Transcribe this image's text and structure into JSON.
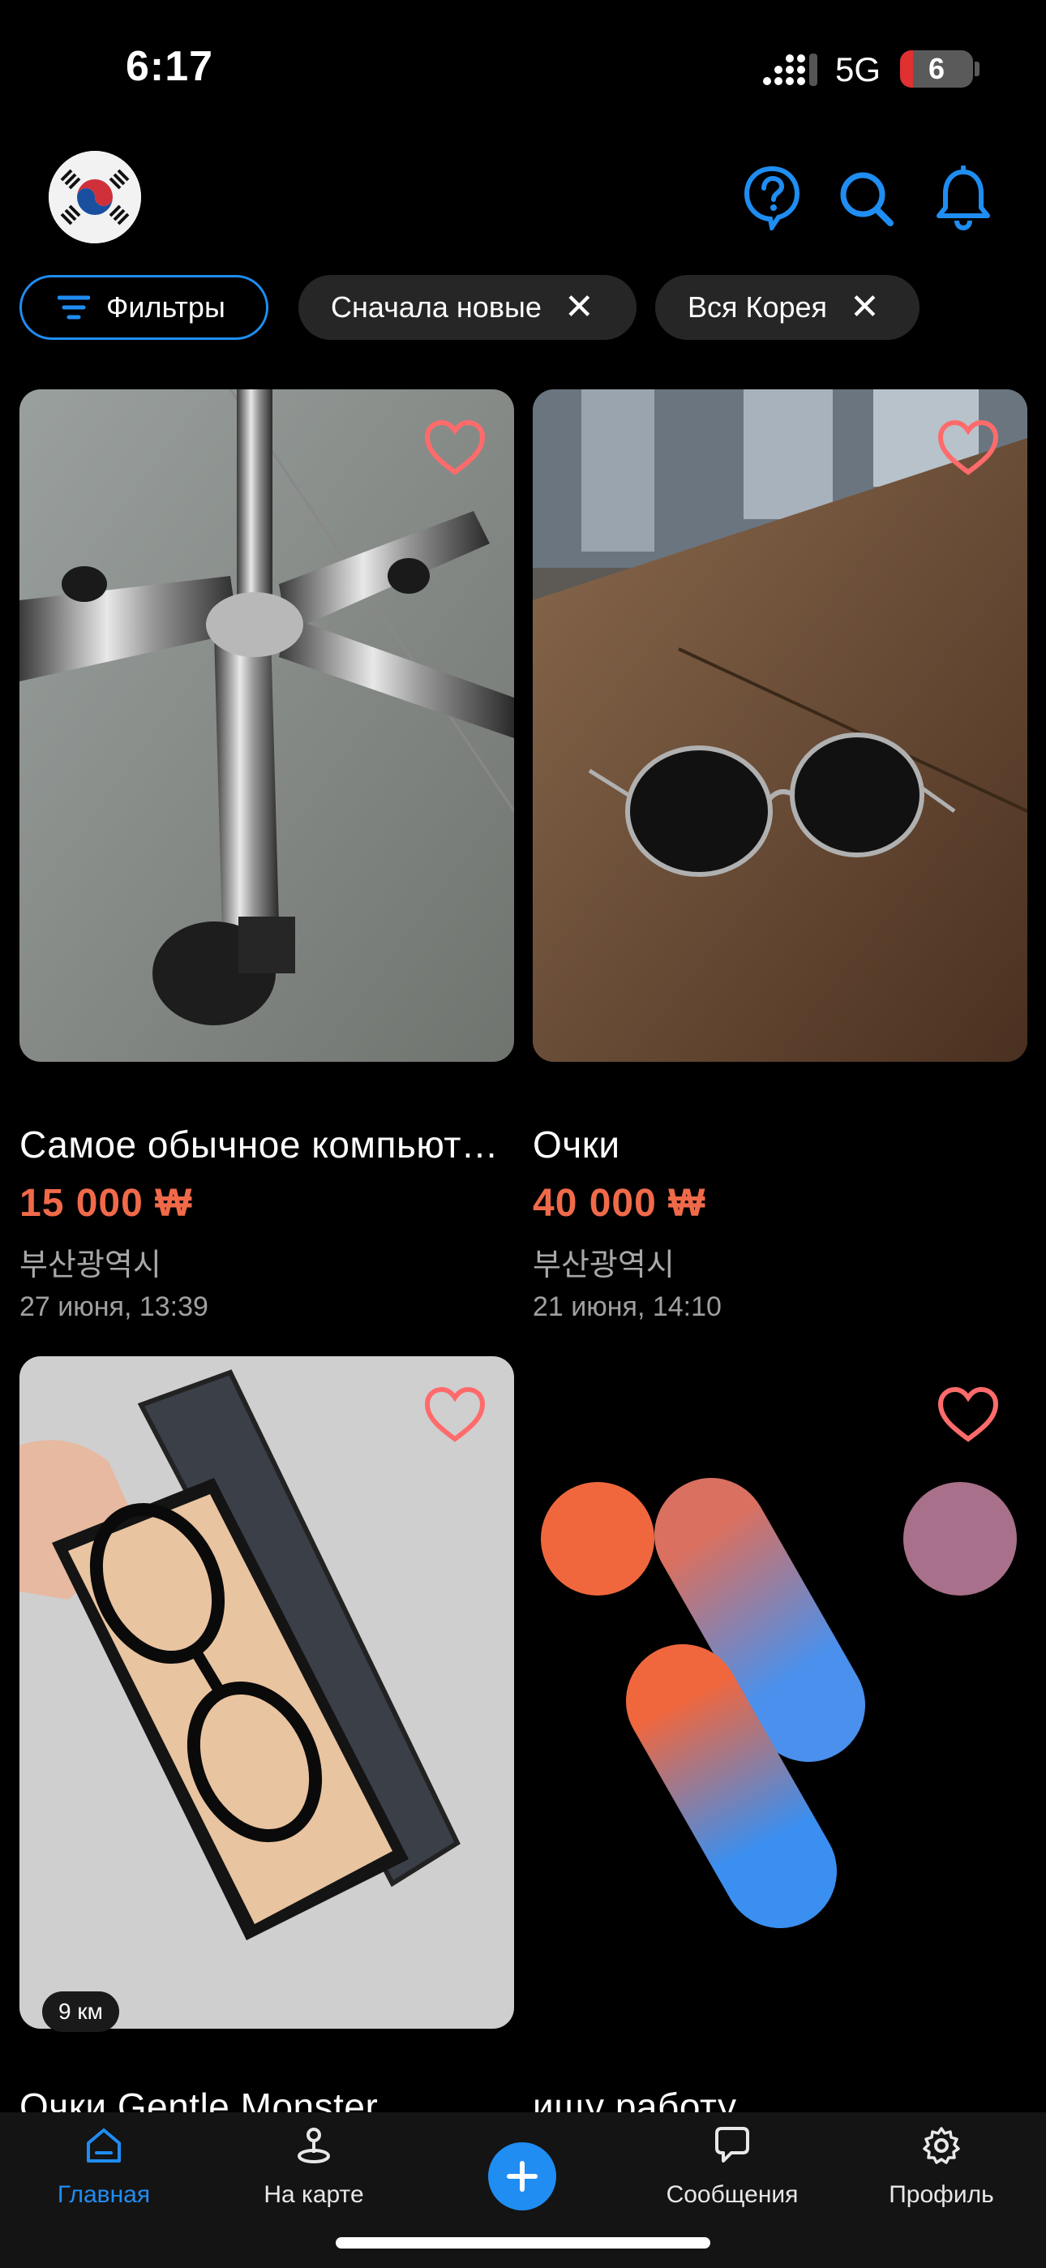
{
  "status": {
    "time": "6:17",
    "network": "5G",
    "battery": "6"
  },
  "header": {
    "flag_icon": "korea-flag-icon",
    "icons": [
      "help-icon",
      "search-icon",
      "bell-icon"
    ],
    "accent": "#1f8df2"
  },
  "chips": {
    "filters": "Фильтры",
    "sort": "Сначала новые",
    "region": "Вся Корея",
    "remove_glyph": "✕"
  },
  "listings": [
    {
      "title": "Самое обычное компьютерное кресло",
      "price": "15 000 ₩",
      "city": "부산광역시",
      "date": "27 июня, 13:39"
    },
    {
      "title": "Очки",
      "price": "40 000 ₩",
      "city": "부산광역시",
      "date": "21 июня, 14:10"
    },
    {
      "title": "Очки Gentle Monster",
      "distance": "9 км"
    },
    {
      "title": "ищу работу"
    }
  ],
  "tabs": [
    {
      "label": "Главная",
      "icon": "home-icon",
      "active": true
    },
    {
      "label": "На карте",
      "icon": "map-pin-icon"
    },
    {
      "label": "",
      "icon": "plus-icon"
    },
    {
      "label": "Сообщения",
      "icon": "chat-icon"
    },
    {
      "label": "Профиль",
      "icon": "gear-icon"
    }
  ],
  "colors": {
    "price": "#f06a4a",
    "heart": "#ff6b6b",
    "accent": "#1f8df2",
    "background": "#000000"
  }
}
